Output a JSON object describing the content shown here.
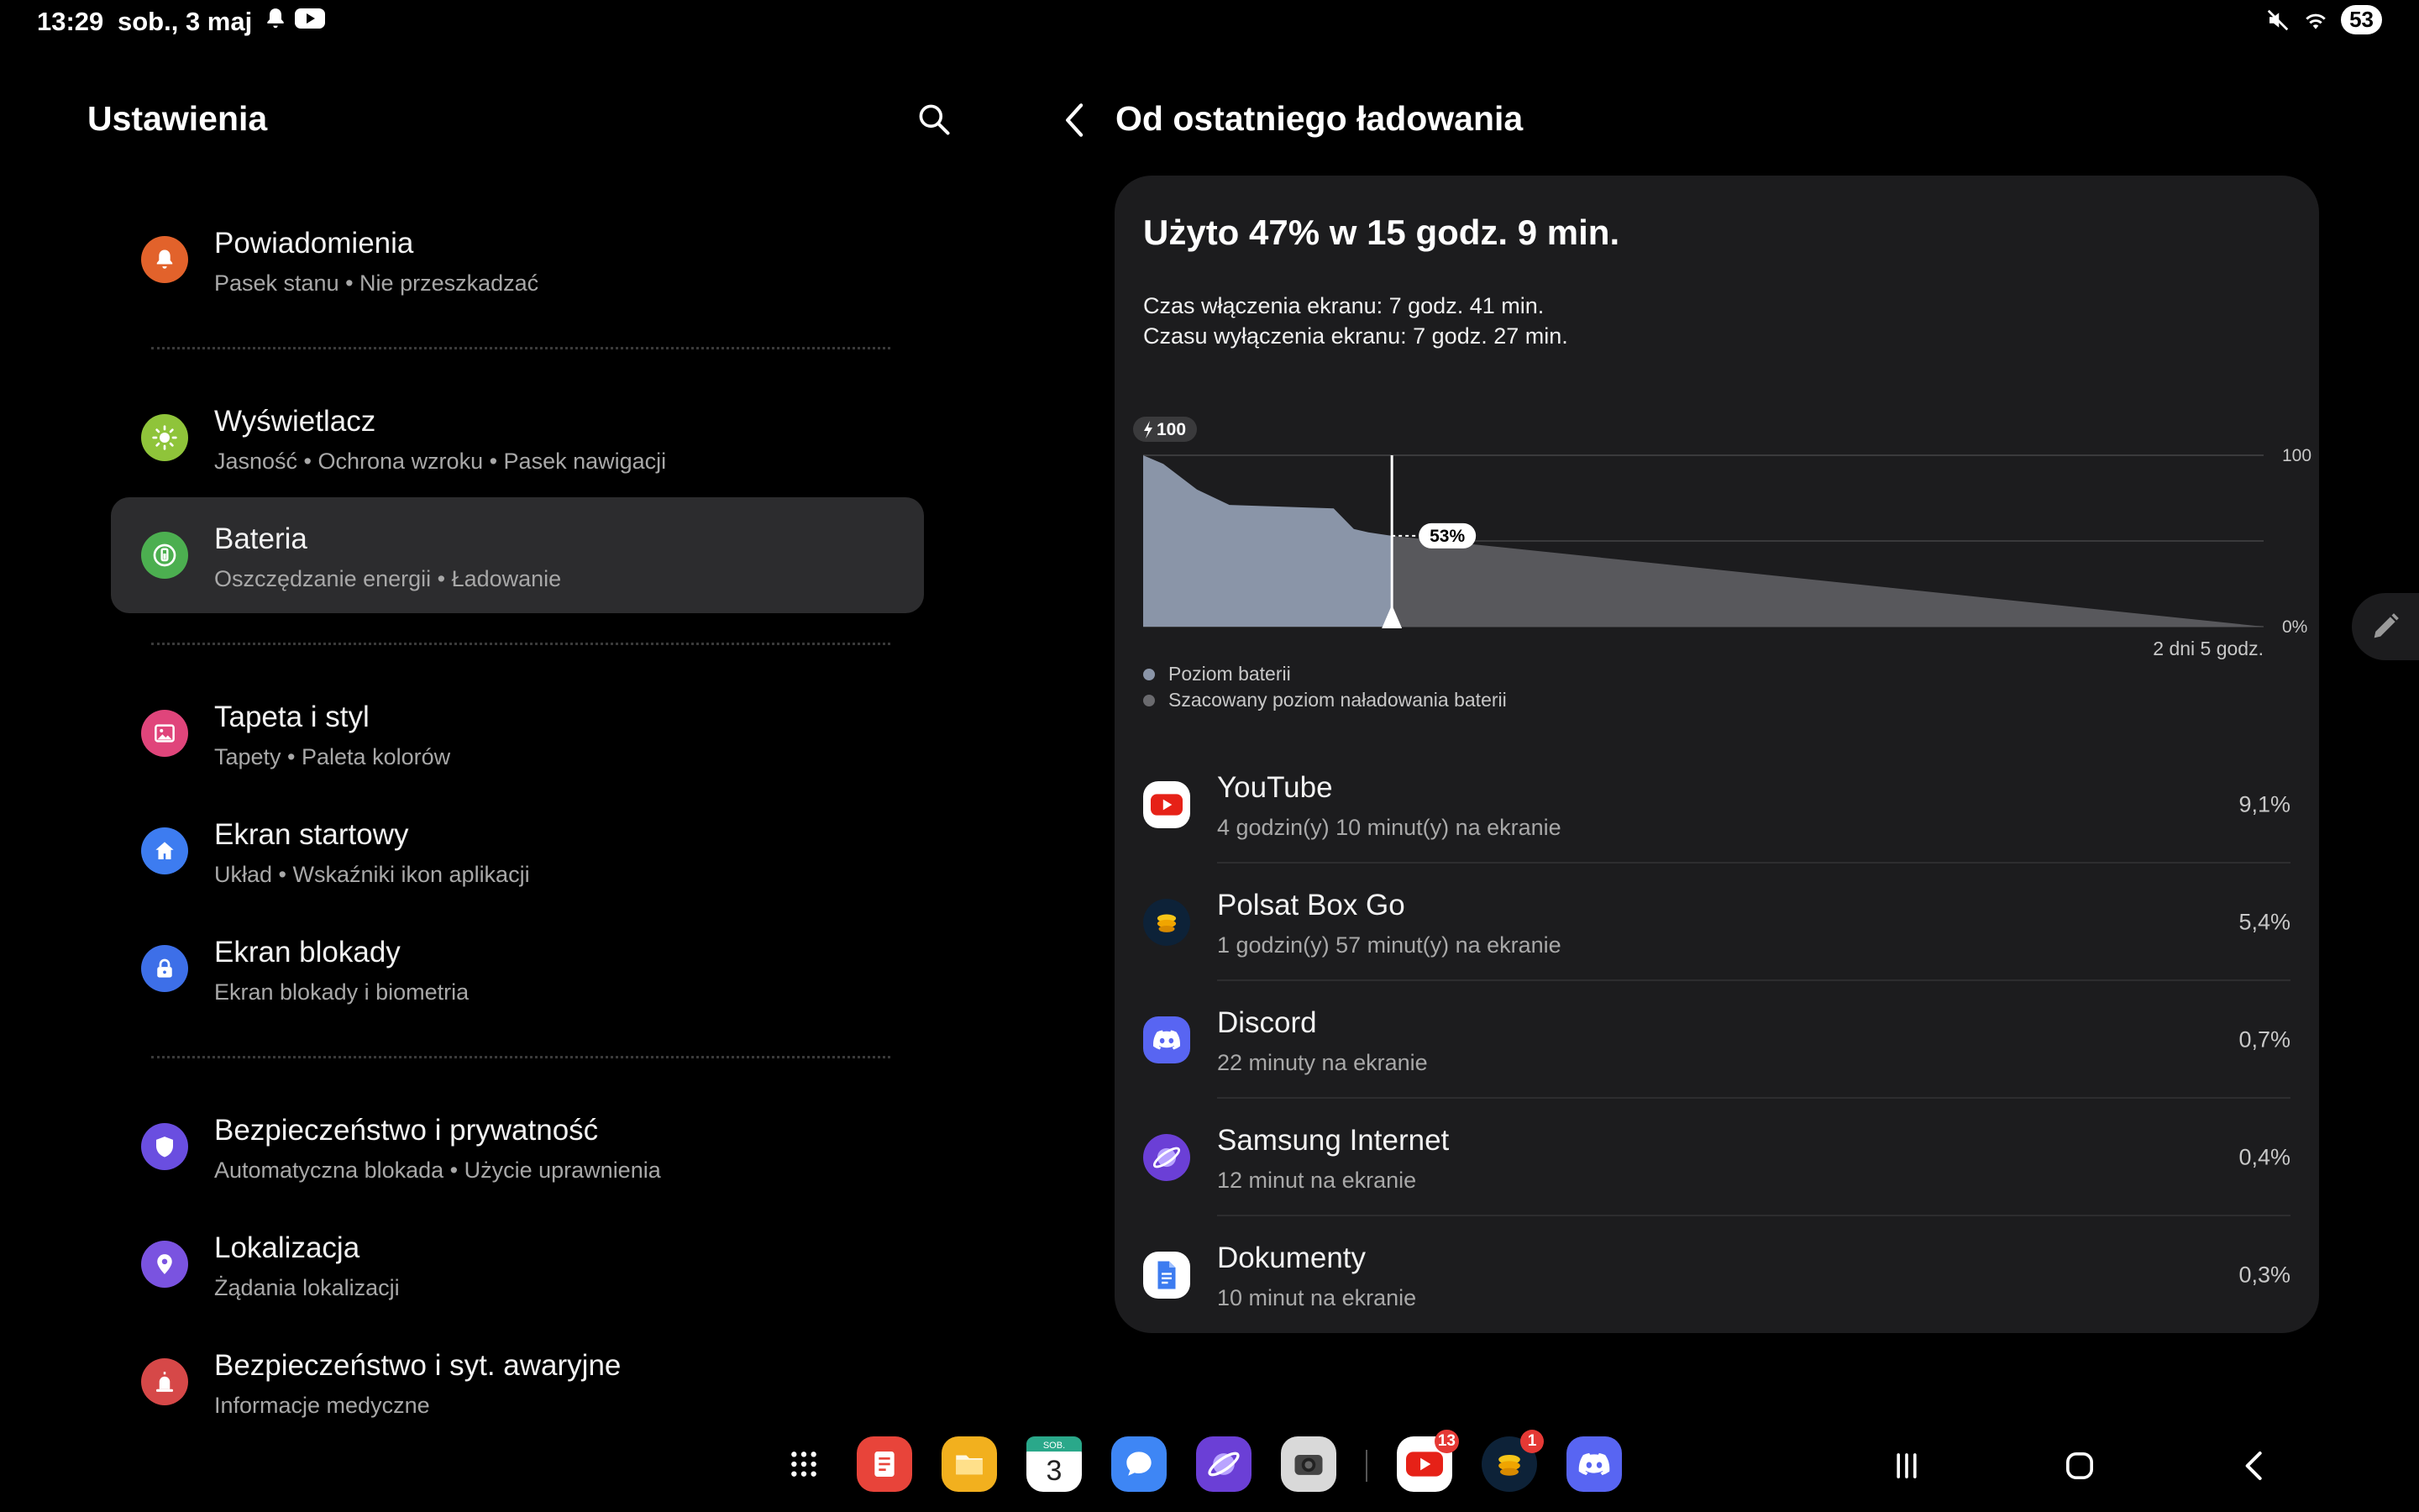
{
  "status_bar": {
    "time": "13:29",
    "date": "sob., 3 maj",
    "battery": "53"
  },
  "left_pane": {
    "title": "Ustawienia",
    "items": [
      {
        "title": "Powiadomienia",
        "subtitle": "Pasek stanu  •  Nie przeszkadzać",
        "icon": "bell-icon",
        "color": "#e2622b"
      },
      {
        "title": "Wyświetlacz",
        "subtitle": "Jasność  •  Ochrona wzroku  •  Pasek nawigacji",
        "icon": "sun-icon",
        "color": "#8fc43a"
      },
      {
        "title": "Bateria",
        "subtitle": "Oszczędzanie energii  •  Ładowanie",
        "icon": "battery-icon",
        "color": "#4caf50"
      },
      {
        "title": "Tapeta i styl",
        "subtitle": "Tapety  •  Paleta kolorów",
        "icon": "image-icon",
        "color": "#e0457b"
      },
      {
        "title": "Ekran startowy",
        "subtitle": "Układ  •  Wskaźniki ikon aplikacji",
        "icon": "home-icon",
        "color": "#3d7cf0"
      },
      {
        "title": "Ekran blokady",
        "subtitle": "Ekran blokady i biometria",
        "icon": "lock-icon",
        "color": "#3d6fe8"
      },
      {
        "title": "Bezpieczeństwo i prywatność",
        "subtitle": "Automatyczna blokada  •  Użycie uprawnienia",
        "icon": "shield-icon",
        "color": "#6a4ee0"
      },
      {
        "title": "Lokalizacja",
        "subtitle": "Żądania lokalizacji",
        "icon": "location-pin-icon",
        "color": "#7a53e0"
      },
      {
        "title": "Bezpieczeństwo i syt. awaryjne",
        "subtitle": "Informacje medyczne",
        "icon": "emergency-icon",
        "color": "#d64848"
      }
    ]
  },
  "right_pane": {
    "title": "Od ostatniego ładowania",
    "heading": "Użyto 47% w 15 godz. 9 min.",
    "screen_on": "Czas włączenia ekranu: 7 godz. 41 min.",
    "screen_off": "Czasu wyłączenia ekranu: 7 godz. 27 min.",
    "legend": [
      {
        "label": "Poziom baterii",
        "color": "#8a95a8"
      },
      {
        "label": "Szacowany poziom naładowania baterii",
        "color": "#6a6a6e"
      }
    ],
    "apps": [
      {
        "name": "YouTube",
        "usage": "4 godzin(y) 10 minut(y) na ekranie",
        "percent": "9,1%",
        "icon": "youtube-icon"
      },
      {
        "name": "Polsat Box Go",
        "usage": "1 godzin(y) 57 minut(y) na ekranie",
        "percent": "5,4%",
        "icon": "polsat-icon"
      },
      {
        "name": "Discord",
        "usage": "22 minuty na ekranie",
        "percent": "0,7%",
        "icon": "discord-icon"
      },
      {
        "name": "Samsung Internet",
        "usage": "12 minut na ekranie",
        "percent": "0,4%",
        "icon": "samsung-internet-icon"
      },
      {
        "name": "Dokumenty",
        "usage": "10 minut na ekranie",
        "percent": "0,3%",
        "icon": "document-icon"
      }
    ]
  },
  "chart_data": {
    "type": "area",
    "charge_label": "100",
    "current_label": "53%",
    "y_axis_labels": [
      "100",
      "0%"
    ],
    "x_end_label": "2 dni 5 godz.",
    "ylim": [
      0,
      100
    ],
    "x_unit": "fraction of timeline",
    "series": [
      {
        "name": "Poziom baterii",
        "x": [
          0.0,
          0.018,
          0.048,
          0.077,
          0.17,
          0.188,
          0.201,
          0.222
        ],
        "y": [
          100,
          95,
          80,
          71,
          69,
          57,
          55,
          53
        ]
      },
      {
        "name": "Szacowany poziom naładowania baterii",
        "x": [
          0.222,
          1.0
        ],
        "y": [
          53,
          0
        ]
      }
    ],
    "current_x": 0.222,
    "grid": true
  },
  "dock": {
    "apps": [
      {
        "name": "apps-grid-icon",
        "badge": ""
      },
      {
        "name": "notes-icon",
        "badge": ""
      },
      {
        "name": "files-icon",
        "badge": ""
      },
      {
        "name": "calendar-icon",
        "badge": "",
        "day": "3",
        "weekday": "SOB."
      },
      {
        "name": "messages-icon",
        "badge": ""
      },
      {
        "name": "samsung-internet-icon",
        "badge": ""
      },
      {
        "name": "camera-icon",
        "badge": ""
      },
      {
        "name": "youtube-icon",
        "badge": "13"
      },
      {
        "name": "polsat-icon",
        "badge": "1"
      },
      {
        "name": "discord-icon",
        "badge": ""
      }
    ]
  }
}
